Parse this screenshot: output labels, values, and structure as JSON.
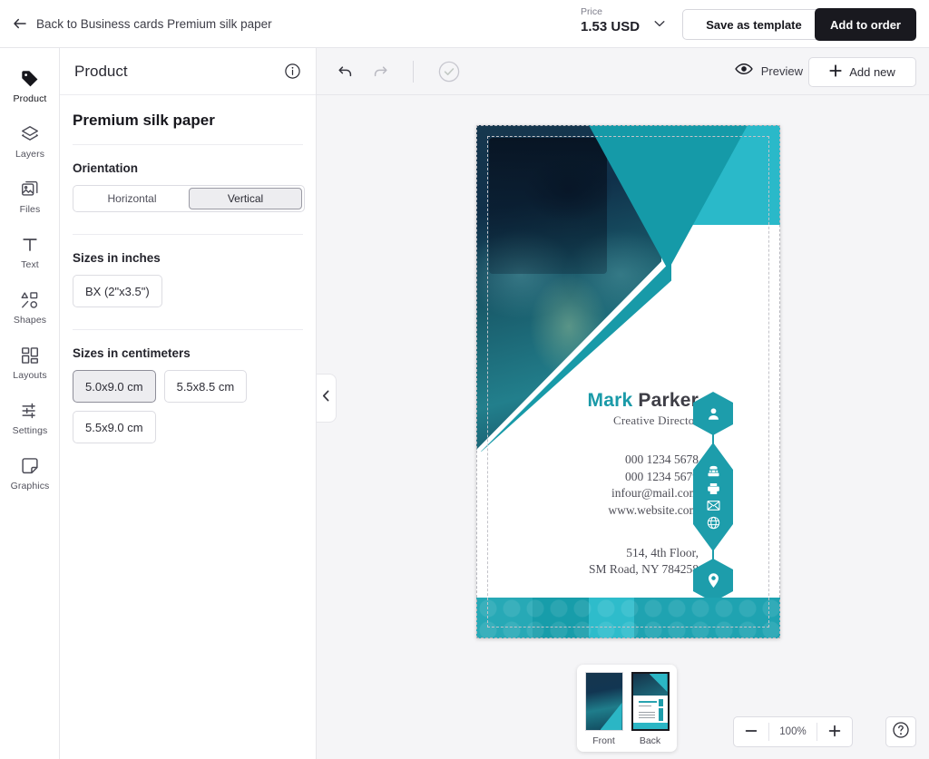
{
  "topbar": {
    "back_label": "Back to Business cards Premium silk paper",
    "price_label": "Price",
    "price_value": "1.53 USD",
    "save_template_label": "Save as template",
    "add_to_order_label": "Add to order"
  },
  "rail": {
    "items": [
      {
        "label": "Product",
        "icon": "tag-icon",
        "active": true
      },
      {
        "label": "Layers",
        "icon": "layers-icon",
        "active": false
      },
      {
        "label": "Files",
        "icon": "files-icon",
        "active": false
      },
      {
        "label": "Text",
        "icon": "text-icon",
        "active": false
      },
      {
        "label": "Shapes",
        "icon": "shapes-icon",
        "active": false
      },
      {
        "label": "Layouts",
        "icon": "layouts-icon",
        "active": false
      },
      {
        "label": "Settings",
        "icon": "settings-icon",
        "active": false
      },
      {
        "label": "Graphics",
        "icon": "graphics-icon",
        "active": false
      }
    ]
  },
  "panel": {
    "title": "Product",
    "info_icon": "info-icon",
    "product_name": "Premium silk paper",
    "orientation": {
      "label": "Orientation",
      "options": [
        "Horizontal",
        "Vertical"
      ],
      "selected": "Vertical"
    },
    "sizes_inches": {
      "label": "Sizes in inches",
      "options": [
        "BX (2\"x3.5\")"
      ],
      "selected": ""
    },
    "sizes_cm": {
      "label": "Sizes in centimeters",
      "options": [
        "5.0x9.0 cm",
        "5.5x8.5 cm",
        "5.5x9.0 cm"
      ],
      "selected": "5.0x9.0 cm"
    },
    "collapse_icon": "chevron-left-icon"
  },
  "canvas_toolbar": {
    "undo_icon": "undo-icon",
    "redo_icon": "redo-icon",
    "approve_icon": "check-circle-icon",
    "preview_label": "Preview",
    "preview_icon": "eye-icon",
    "add_new_label": "Add new",
    "add_new_icon": "plus-icon"
  },
  "card": {
    "first_name": "Mark",
    "last_name": "Parker",
    "role": "Creative Director",
    "details": [
      "000 1234 5678",
      "000 1234 5679",
      "infour@mail.com",
      "www.website.com"
    ],
    "address": [
      "514, 4th Floor,",
      "SM Road, NY 784258"
    ],
    "hex_icons": [
      "person-icon",
      "phone-icon",
      "printer-icon",
      "envelope-icon",
      "globe-icon",
      "map-pin-icon"
    ],
    "colors": {
      "teal": "#1d9dab",
      "teal_light": "#2ab9c9",
      "teal_mid": "#159aa8",
      "band": "#2db5c2",
      "name_accent": "#1a9aa8",
      "name_dark": "#3e3e46"
    }
  },
  "thumbnails": {
    "items": [
      {
        "label": "Front",
        "selected": false
      },
      {
        "label": "Back",
        "selected": true
      }
    ]
  },
  "zoom": {
    "minus_icon": "minus-icon",
    "plus_icon": "plus-icon",
    "value": "100%",
    "help_icon": "question-circle-icon"
  }
}
